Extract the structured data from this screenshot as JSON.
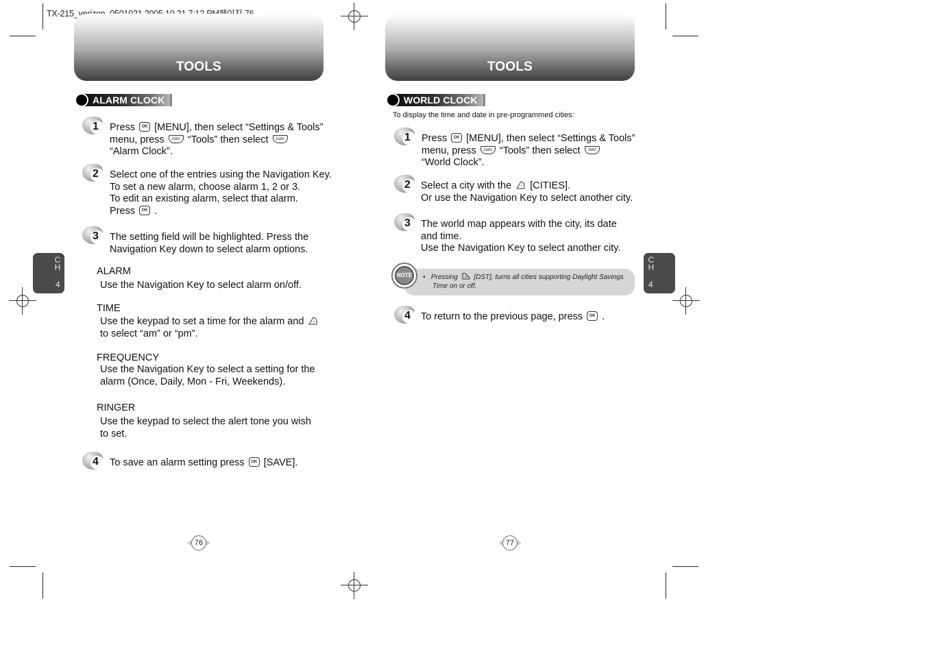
{
  "print_header": "TX-215_verizon_0501021  2005.10.21  7:12 PM페이지 76",
  "left_page": {
    "banner_title": "TOOLS",
    "section_label": "ALARM CLOCK",
    "chapter_tab": {
      "ch_c": "C",
      "ch_h": "H",
      "number": "4"
    },
    "steps": [
      {
        "number": "1",
        "lines": [
          {
            "parts": [
              "Press ",
              "[MENU], then select “Settings & Tools”"
            ]
          },
          {
            "parts": [
              "menu, press ",
              "“Tools” then select "
            ]
          },
          {
            "parts": [
              "“Alarm Clock”."
            ]
          }
        ]
      },
      {
        "number": "2",
        "lines": [
          {
            "parts": [
              "Select one of the entries using the Navigation Key."
            ]
          },
          {
            "parts": [
              "To set a new alarm, choose alarm 1, 2 or 3."
            ]
          },
          {
            "parts": [
              "To edit an existing alarm, select that alarm."
            ]
          },
          {
            "parts": [
              "Press ",
              " ."
            ]
          }
        ]
      },
      {
        "number": "3",
        "lines": [
          {
            "parts": [
              "The setting field will be highlighted. Press the"
            ]
          },
          {
            "parts": [
              "Navigation Key down to select alarm options."
            ]
          }
        ]
      },
      {
        "number": "4",
        "lines": [
          {
            "parts": [
              "To save an alarm setting press ",
              " [SAVE]."
            ]
          }
        ]
      }
    ],
    "options": [
      {
        "title": "ALARM",
        "lines": [
          "Use the Navigation Key to select alarm on/off."
        ]
      },
      {
        "title": "TIME",
        "lines": [
          "Use the keypad to set a time for the alarm and ",
          "to select “am” or “pm”."
        ]
      },
      {
        "title": "FREQUENCY",
        "lines": [
          "Use the Navigation Key to select a setting for the",
          "alarm (Once, Daily, Mon - Fri, Weekends)."
        ]
      },
      {
        "title": "RINGER",
        "lines": [
          "Use the keypad to select the alert tone you wish",
          "to set."
        ]
      }
    ],
    "page_number": "76"
  },
  "right_page": {
    "banner_title": "TOOLS",
    "section_label": "WORLD CLOCK",
    "intro": "To display the time and date in pre-programmed cities:",
    "chapter_tab": {
      "ch_c": "C",
      "ch_h": "H",
      "number": "4"
    },
    "steps": [
      {
        "number": "1",
        "lines": [
          {
            "parts": [
              "Press ",
              "[MENU], then select “Settings & Tools”"
            ]
          },
          {
            "parts": [
              "menu, press ",
              "“Tools” then select "
            ]
          },
          {
            "parts": [
              "“World Clock”."
            ]
          }
        ]
      },
      {
        "number": "2",
        "lines": [
          {
            "parts": [
              "Select a city with the ",
              "[CITIES]."
            ]
          },
          {
            "parts": [
              "Or use the Navigation Key to select another city."
            ]
          }
        ]
      },
      {
        "number": "3",
        "lines": [
          {
            "parts": [
              "The world map appears with the city, its date"
            ]
          },
          {
            "parts": [
              "and time."
            ]
          },
          {
            "parts": [
              "Use the Navigation Key to select another city."
            ]
          }
        ]
      },
      {
        "number": "4",
        "lines": [
          {
            "parts": [
              "To return to the previous page, press ",
              " ."
            ]
          }
        ]
      }
    ],
    "note": {
      "icon_label": "NOTE",
      "bullet": "•",
      "line1_a": "Pressing ",
      "line1_b": "[DST], turns all cities supporting Daylight Savings",
      "line2": "Time on or off."
    },
    "page_number": "77"
  },
  "keys": {
    "ok": "OK",
    "two": "2abc",
    "three": "3def"
  }
}
